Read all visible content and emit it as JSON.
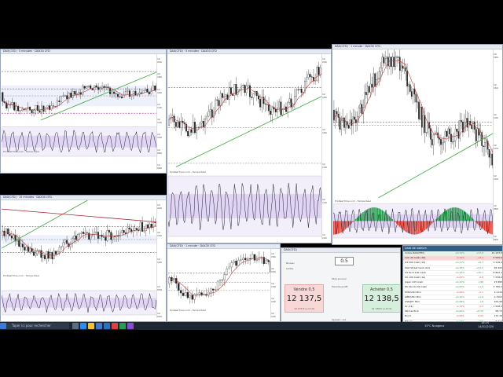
{
  "panels": {
    "tl": {
      "instrument": "DAX(CFD)",
      "timeframe": "5 minutes",
      "extra": "DAX30 CFD"
    },
    "tm": {
      "instrument": "DAX(CFD)",
      "timeframe": "5 minutes",
      "extra": "DAX30 CFD"
    },
    "tr": {
      "instrument": "DAX(CFD)",
      "timeframe": "1 minute",
      "extra": "DAX30 CFD"
    },
    "bl": {
      "instrument": "DAX(CFD)",
      "timeframe": "15 minutes",
      "extra": "DAX30 CFD"
    },
    "bm": {
      "instrument": "DAX(CFD)",
      "timeframe": "1 minute",
      "extra": "DAX30 CFD"
    }
  },
  "axes": {
    "tl": [
      "12 200",
      "12 180",
      "12 160",
      "12 140",
      "12 120",
      "12 100",
      "12 080",
      "12 060"
    ],
    "tm": [
      "12 200",
      "12 180",
      "12 160",
      "12 140",
      "12 120",
      "12 100"
    ],
    "tr": [
      "12 180",
      "12 160",
      "12 140",
      "12 120",
      "12 100",
      "12 080",
      "12 060"
    ],
    "bl": [
      "12 200",
      "12 150",
      "12 100",
      "12 050",
      "12 000"
    ],
    "bm": [
      "12 180",
      "12 160",
      "12 140",
      "12 120",
      "12 100"
    ]
  },
  "times": {
    "tl": [
      "11:00",
      "12:00",
      "13:00",
      "14:00",
      "15:00",
      "16:00",
      "17:00",
      "18:00"
    ],
    "tm": [
      "12:00",
      "14:00",
      "16:00",
      "18:00"
    ],
    "tr": [
      "16:00",
      "16:10",
      "16:20",
      "16:30",
      "16:40",
      "16:50",
      "17:00",
      "17:10",
      "17:20",
      "17:30",
      "17:40",
      "17:50",
      "18:00",
      "18:10"
    ],
    "bl": [
      "11:00",
      "12:00",
      "13:00",
      "14:00",
      "15:00",
      "16:00",
      "17:00",
      "18:00"
    ],
    "bm": [
      "17:00",
      "17:30",
      "18:00",
      "18:30"
    ]
  },
  "chart_label": "ProRealTime.com - Temps Réel",
  "ticket": {
    "instrument": "DAX(CFD)",
    "quantity": "0.5",
    "sell_label": "Vendre 0,5",
    "sell_price": "12 137,5",
    "buy_label": "Acheter 0,5",
    "buy_price": "12 138,5",
    "sell_sub": "12 137,5 (+17,0)",
    "buy_sub": "12 138,5 (+17,0)",
    "info1": "Niveau",
    "info2": "Limite",
    "stop_label": "Stop suiveur",
    "limit_label": "Prendre profit",
    "footer": "Spread : 1,0"
  },
  "watchlist": {
    "title": "Liste de valeurs",
    "rows": [
      {
        "name": "Indice DAX(CFD)",
        "chg": "+0,11%",
        "pct": "+17,0",
        "val": "12 137,5"
      },
      {
        "name": "CAC 40 Cash (1€)",
        "chg": "-0,24%",
        "pct": "-13,4",
        "val": "5 595,6"
      },
      {
        "name": "US 500 Cash (1$)",
        "chg": "+0,21%",
        "pct": "+6,7",
        "val": "3 218,4"
      },
      {
        "name": "Wall Street Cash (1$)",
        "chg": "+0,18%",
        "pct": "+51,2",
        "val": "28 405"
      },
      {
        "name": "US Tech 100 Cash",
        "chg": "+0,34%",
        "pct": "+30,1",
        "val": "8 802,1"
      },
      {
        "name": "UK 100 Cash (1£)",
        "chg": "-0,09%",
        "pct": "-6,8",
        "val": "7 558,9"
      },
      {
        "name": "Japan 225 Cash",
        "chg": "+0,42%",
        "pct": "+98",
        "val": "23 880"
      },
      {
        "name": "EU Stocks 50 Cash",
        "chg": "+0,05%",
        "pct": "+1,9",
        "val": "3 780,2"
      },
      {
        "name": "EUR/USD Mini",
        "chg": "-0,06%",
        "pct": "-0,7",
        "val": "1,1134"
      },
      {
        "name": "GBP/USD Mini",
        "chg": "+0,12%",
        "pct": "+1,6",
        "val": "1,3102"
      },
      {
        "name": "USD/JPY Mini",
        "chg": "+0,08%",
        "pct": "+9",
        "val": "109,48"
      },
      {
        "name": "Or (1$)",
        "chg": "-0,15%",
        "pct": "-2,3",
        "val": "1 548,5"
      },
      {
        "name": "Pétrole Brut",
        "chg": "+0,60%",
        "pct": "+0,35",
        "val": "58,72"
      },
      {
        "name": "Bund",
        "chg": "-0,02%",
        "pct": "-0,04",
        "val": "172,36"
      },
      {
        "name": "Bitcoin",
        "chg": "+1,22%",
        "pct": "+105",
        "val": "8 712"
      }
    ]
  },
  "taskbar": {
    "search_placeholder": "Taper ici pour rechercher",
    "weather": "15°C  Nuageux",
    "time": "18:25",
    "date": "14/01/2020"
  }
}
